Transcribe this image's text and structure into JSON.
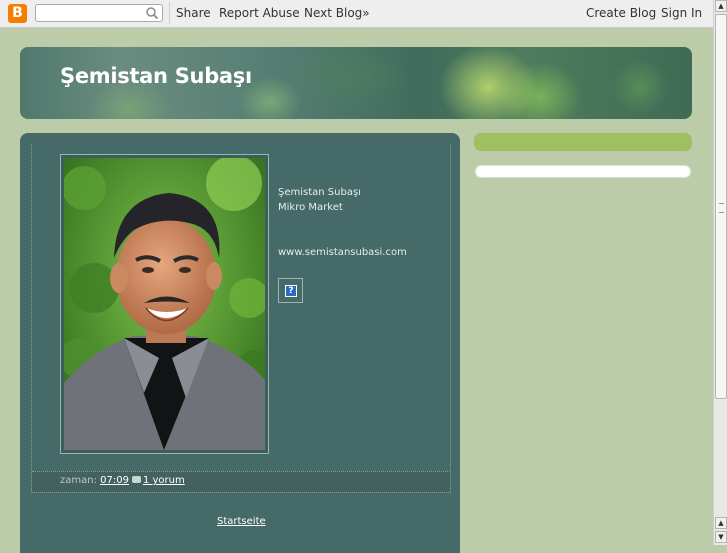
{
  "navbar": {
    "logo_letter": "B",
    "search": {
      "value": "",
      "placeholder": ""
    },
    "links": {
      "share": "Share",
      "report_abuse": "Report Abuse",
      "next_blog": "Next Blog»",
      "create_blog": "Create Blog",
      "sign_in": "Sign In"
    }
  },
  "header": {
    "title": "Şemistan Subaşı"
  },
  "post": {
    "lines": [
      "Şemistan Subaşı",
      "Mikro Market",
      "",
      "",
      "www.semistansubasi.com"
    ],
    "image_placeholder": "?",
    "footer": {
      "label": "zaman:",
      "time": "07:09",
      "comments": "1 yorum"
    }
  },
  "home_link": "Startseite",
  "colors": {
    "page_bg": "#bccca9",
    "main_bg": "#456a68",
    "sidebar_accent": "#9fbf62"
  }
}
